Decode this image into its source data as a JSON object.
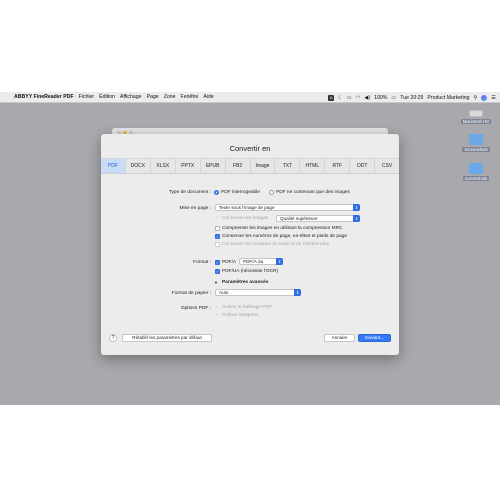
{
  "menubar": {
    "app": "ABBYY FineReader PDF",
    "items": [
      "Fichier",
      "Édition",
      "Affichage",
      "Page",
      "Zone",
      "Fenêtre",
      "Aide"
    ],
    "battery": "100%",
    "clock": "Tue 20:29",
    "user": "Product Marketing"
  },
  "desktop": {
    "icons": [
      {
        "label": "Macintosh HD",
        "color": "#d9d9dc"
      },
      {
        "label": "Screenshots",
        "color": "#6aa8e8"
      },
      {
        "label": "screenshots",
        "color": "#6aa8e8"
      }
    ]
  },
  "dialog": {
    "title": "Convertir en",
    "tabs": [
      "PDF",
      "DOCX",
      "XLSX",
      "PPTX",
      "EPUB",
      "FB2",
      "Image",
      "TXT",
      "HTML",
      "RTF",
      "ODT",
      "CSV"
    ],
    "active_tab": "PDF",
    "doc_type_label": "Type de document :",
    "doc_type_options": [
      "PDF interrogeable",
      "PDF ne contenant que des images"
    ],
    "layout_label": "Mise en page :",
    "layout_value": "Texte sous l'image de page",
    "keep_images": "Conserver les images",
    "quality_value": "Qualité supérieure",
    "mrc": "Compresser les images en utilisant la compression MRC",
    "keep_numbers": "Conserver les numéros de page, en-têtes et pieds de page",
    "keep_colors": "Conserver les couleurs du texte et de l'arrière-plan",
    "format_label": "Format :",
    "pdfa": "PDF/A",
    "pdfa_value": "PDF/A-3a",
    "pdfua": "PDF/UA (nécessite l'OCR)",
    "advanced": "Paramètres avancés",
    "paper_label": "Format de papier :",
    "paper_value": "Auto",
    "options_label": "Options PDF :",
    "tagging": "Activer le balisage PDF",
    "fonts": "Polices intégrées",
    "help": "?",
    "reset": "Rétablir les paramètres par défaut",
    "cancel": "Annuler",
    "next": "Suivant..."
  },
  "colors": {
    "accent": "#3478f6",
    "desktop": "#a9a9ad"
  }
}
